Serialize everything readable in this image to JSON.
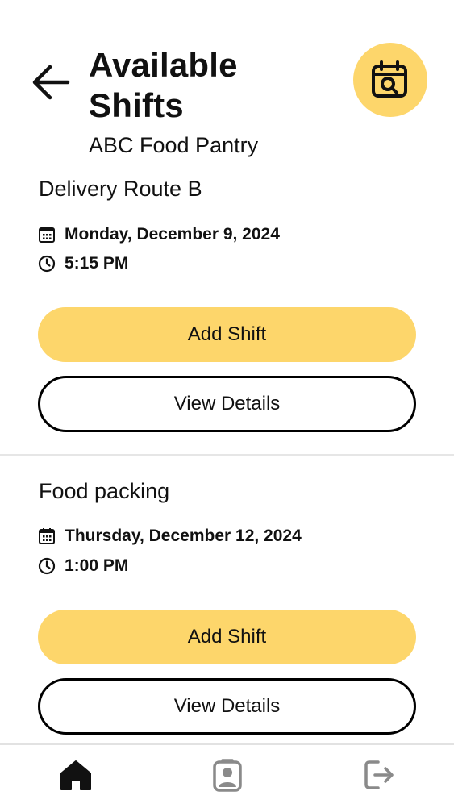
{
  "header": {
    "title": "Available Shifts",
    "subtitle": "ABC Food Pantry",
    "back_icon": "arrow-left-icon",
    "search_calendar_icon": "calendar-search-icon"
  },
  "shifts": [
    {
      "title": "Delivery Route B",
      "date": "Monday, December 9, 2024",
      "time": "5:15 PM",
      "add_label": "Add Shift",
      "details_label": "View Details"
    },
    {
      "title": "Food packing",
      "date": "Thursday, December 12, 2024",
      "time": "1:00 PM",
      "add_label": "Add Shift",
      "details_label": "View Details"
    }
  ],
  "nav": {
    "items": [
      {
        "icon": "home-icon",
        "active": true
      },
      {
        "icon": "profile-badge-icon",
        "active": false
      },
      {
        "icon": "logout-icon",
        "active": false
      }
    ]
  },
  "colors": {
    "accent": "#FDD66B",
    "text": "#111111",
    "inactive_icon": "#8a8a8a"
  }
}
